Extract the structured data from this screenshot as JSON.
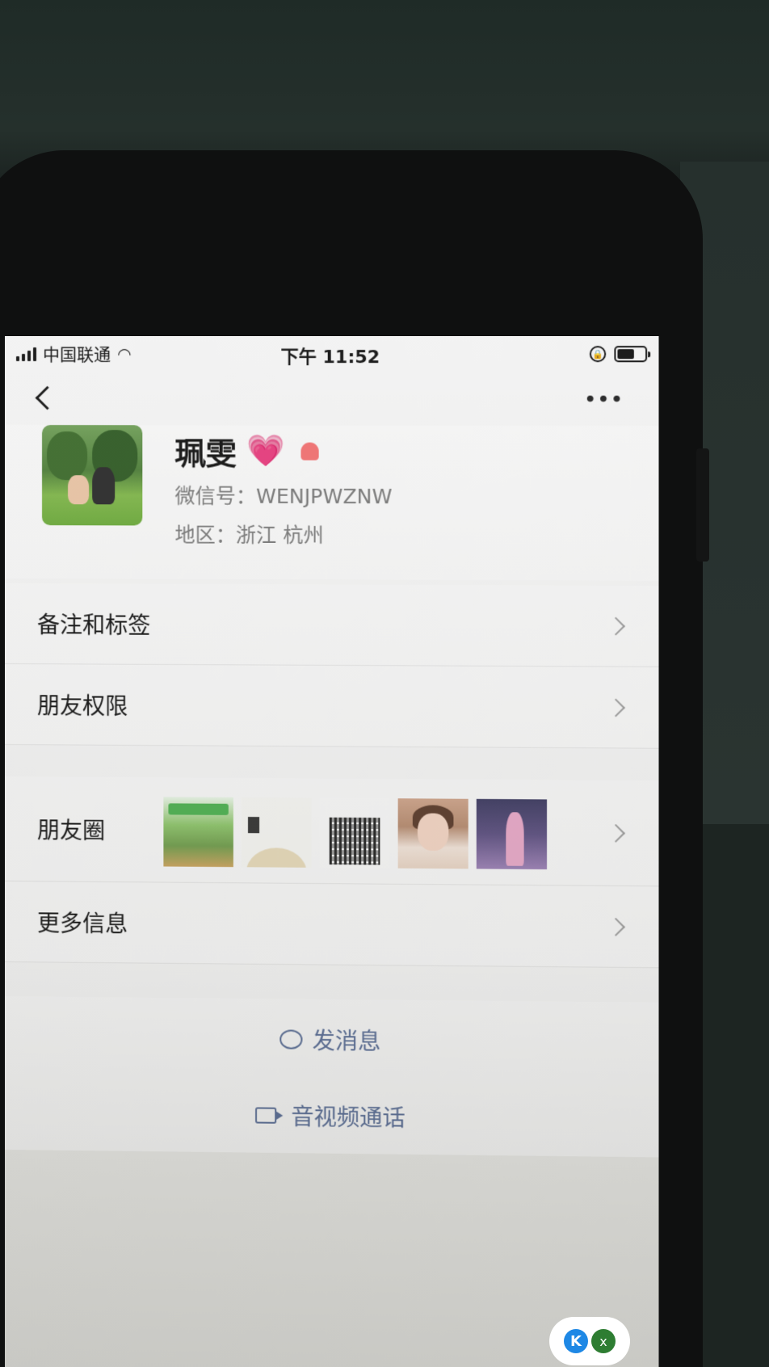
{
  "status_bar": {
    "carrier": "中国联通",
    "time": "下午 11:52"
  },
  "profile": {
    "name": "珮雯",
    "heart_emoji": "💗",
    "wechat_id": "微信号：WENJPWZNW",
    "region": "地区：浙江 杭州"
  },
  "rows": {
    "remarks_tags": "备注和标签",
    "friend_permissions": "朋友权限",
    "moments": "朋友圈",
    "more_info": "更多信息"
  },
  "actions": {
    "send_message": "发消息",
    "av_call": "音视频通话"
  },
  "floating_badge": {
    "k": "K",
    "x": "x"
  },
  "icons": [
    "back-icon",
    "more-icon",
    "wifi-icon",
    "battery-icon",
    "gender-female-icon",
    "message-icon",
    "video-icon"
  ]
}
